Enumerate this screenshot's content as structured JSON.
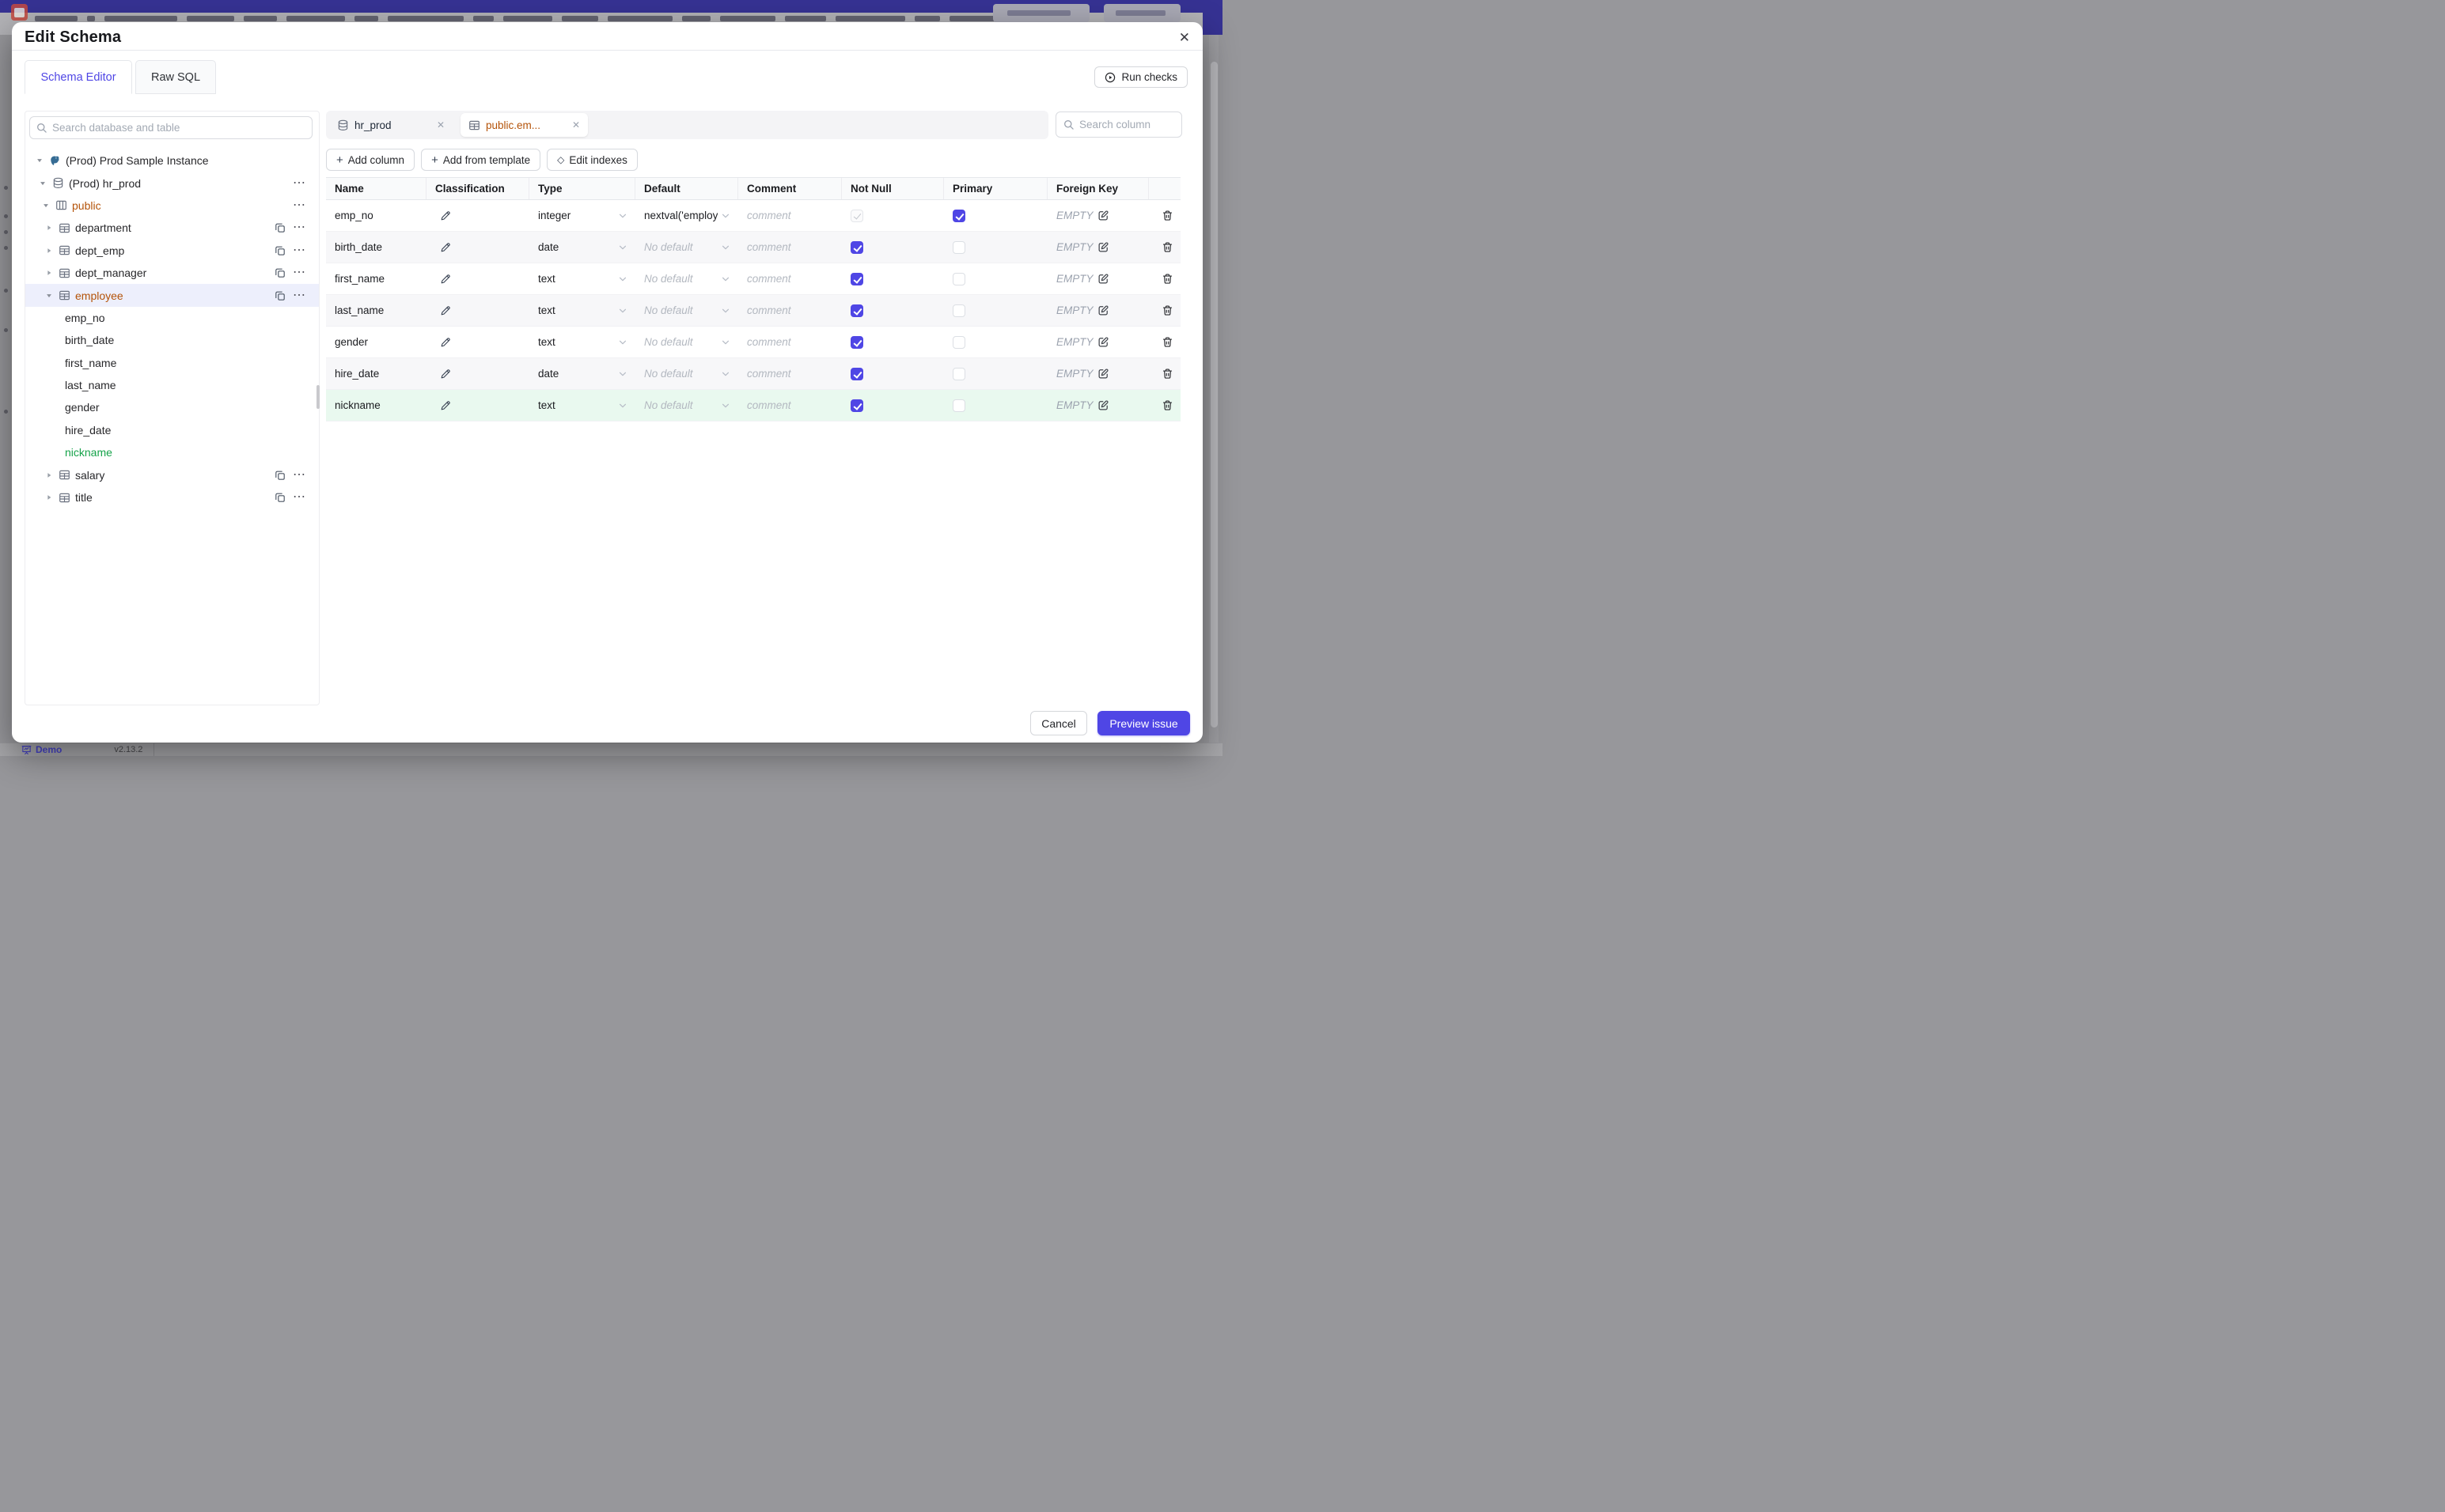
{
  "backdrop": {
    "bottom_bar": {
      "brand": "Demo",
      "version": "v2.13.2"
    }
  },
  "colors": {
    "accent": "#4f46e5",
    "topbar": "#363293",
    "table_name_highlight": "#b45309",
    "new_column_green": "#16a34a",
    "selected_row_bg": "#edeffc",
    "new_row_bg": "#e9f9ef"
  },
  "modal": {
    "title": "Edit Schema",
    "close_label": "✕",
    "tabs": [
      {
        "label": "Schema Editor"
      },
      {
        "label": "Raw SQL"
      }
    ],
    "run_checks_label": "Run checks",
    "sidebar": {
      "search_placeholder": "Search database and table",
      "tree": [
        {
          "label": "(Prod) Prod Sample Instance"
        },
        {
          "label": "(Prod) hr_prod"
        },
        {
          "label": "public"
        },
        {
          "label": "department"
        },
        {
          "label": "dept_emp"
        },
        {
          "label": "dept_manager"
        },
        {
          "label": "employee"
        },
        {
          "label": "emp_no"
        },
        {
          "label": "birth_date"
        },
        {
          "label": "first_name"
        },
        {
          "label": "last_name"
        },
        {
          "label": "gender"
        },
        {
          "label": "hire_date"
        },
        {
          "label": "nickname"
        },
        {
          "label": "salary"
        },
        {
          "label": "title"
        }
      ]
    },
    "editor": {
      "open_tabs": [
        {
          "label": "hr_prod"
        },
        {
          "label": "public.em..."
        }
      ],
      "column_search_placeholder": "Search column",
      "toolbar": {
        "add_column": "Add column",
        "add_from_template": "Add from template",
        "edit_indexes": "Edit indexes"
      },
      "table": {
        "headers": [
          "Name",
          "Classification",
          "Type",
          "Default",
          "Comment",
          "Not Null",
          "Primary",
          "Foreign Key"
        ],
        "comment_placeholder": "comment",
        "foreign_key_empty": "EMPTY",
        "rows": [
          {
            "name": "emp_no",
            "type": "integer",
            "default": "nextval('employ"
          },
          {
            "name": "birth_date",
            "type": "date",
            "default": "No default"
          },
          {
            "name": "first_name",
            "type": "text",
            "default": "No default"
          },
          {
            "name": "last_name",
            "type": "text",
            "default": "No default"
          },
          {
            "name": "gender",
            "type": "text",
            "default": "No default"
          },
          {
            "name": "hire_date",
            "type": "date",
            "default": "No default"
          },
          {
            "name": "nickname",
            "type": "text",
            "default": "No default"
          }
        ]
      }
    },
    "footer": {
      "cancel": "Cancel",
      "submit": "Preview issue"
    }
  }
}
